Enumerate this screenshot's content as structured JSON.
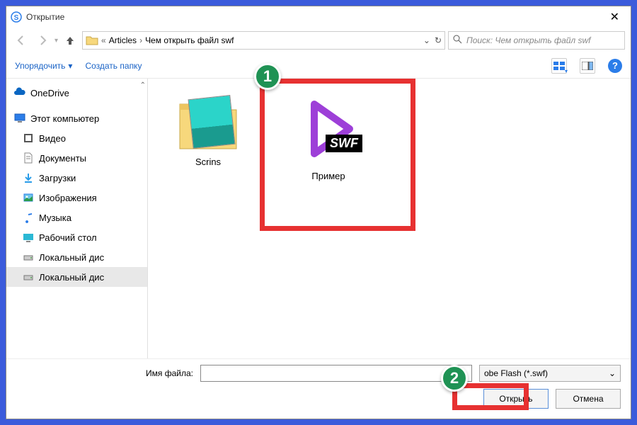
{
  "title": "Открытие",
  "breadcrumbs": {
    "prefix": "«",
    "item1": "Articles",
    "item2": "Чем открыть файл swf"
  },
  "search": {
    "placeholder": "Поиск: Чем открыть файл swf"
  },
  "toolbar": {
    "organize": "Упорядочить",
    "new_folder": "Создать папку"
  },
  "sidebar": {
    "onedrive": "OneDrive",
    "this_pc": "Этот компьютер",
    "video": "Видео",
    "documents": "Документы",
    "downloads": "Загрузки",
    "images": "Изображения",
    "music": "Музыка",
    "desktop": "Рабочий стол",
    "localdisk1": "Локальный дис",
    "localdisk2": "Локальный дис"
  },
  "files": {
    "folder_name": "Scrins",
    "swf_name": "Пример",
    "swf_badge": "SWF"
  },
  "footer": {
    "filename_label": "Имя файла:",
    "filename_value": "",
    "filter": "obe Flash (*.swf)",
    "open": "Открыть",
    "cancel": "Отмена"
  },
  "badges": {
    "one": "1",
    "two": "2"
  }
}
